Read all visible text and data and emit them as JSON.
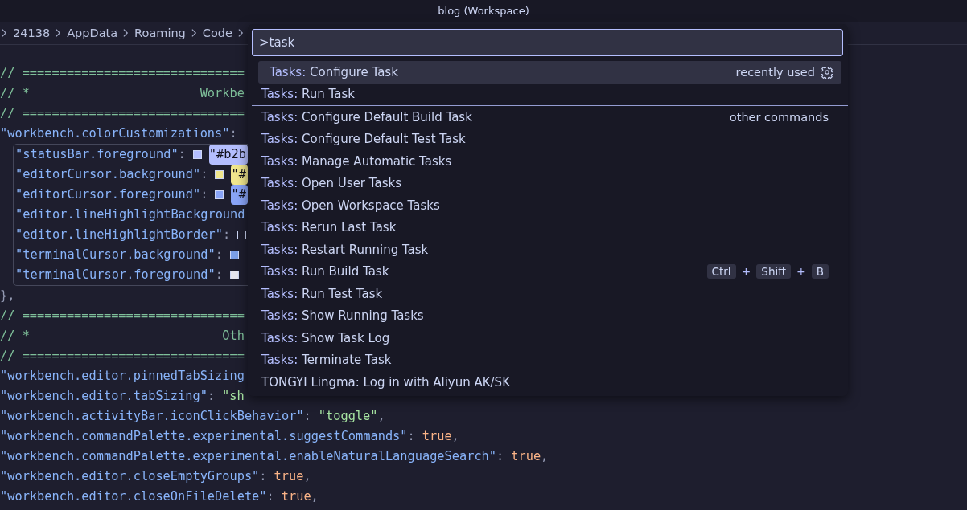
{
  "window": {
    "title": "blog (Workspace)"
  },
  "breadcrumb": [
    "24138",
    "AppData",
    "Roaming",
    "Code"
  ],
  "editor": {
    "lines_before": [
      [
        {
          "kind": "comment",
          "text": "// =============================="
        }
      ],
      [
        {
          "kind": "comment",
          "text": "// *                       Workbe"
        }
      ],
      [
        {
          "kind": "comment",
          "text": "// =============================="
        }
      ],
      [
        {
          "kind": "key",
          "text": "\"workbench.colorCustomizations\""
        },
        {
          "kind": "punct",
          "text": ":"
        }
      ]
    ],
    "block_lines": [
      [
        {
          "kind": "key",
          "text": "\"statusBar.foreground\""
        },
        {
          "kind": "punct",
          "text": ":"
        },
        {
          "kind": "swatch",
          "color": "#b4befe"
        },
        {
          "kind": "value",
          "text": "\"#b2b",
          "color": "#b4befe"
        }
      ],
      [
        {
          "kind": "key",
          "text": "\"editorCursor.background\""
        },
        {
          "kind": "punct",
          "text": ":"
        },
        {
          "kind": "swatch",
          "color": "#f0e68c"
        },
        {
          "kind": "value",
          "text": "\"#",
          "color": "#f0e68c"
        }
      ],
      [
        {
          "kind": "key",
          "text": "\"editorCursor.foreground\""
        },
        {
          "kind": "punct",
          "text": ":"
        },
        {
          "kind": "swatch",
          "color": "#89a4f7"
        },
        {
          "kind": "value",
          "text": "\"#",
          "color": "#89a4f7"
        }
      ],
      [
        {
          "kind": "key",
          "text": "\"editor.lineHighlightBackground"
        }
      ],
      [
        {
          "kind": "key",
          "text": "\"editor.lineHighlightBorder\""
        },
        {
          "kind": "punct",
          "text": ":"
        },
        {
          "kind": "swatch",
          "color": "#1e1e2e"
        }
      ],
      [
        {
          "kind": "key",
          "text": "\"terminalCursor.background\""
        },
        {
          "kind": "punct",
          "text": ":"
        },
        {
          "kind": "swatch",
          "color": "#7b9ee6"
        }
      ],
      [
        {
          "kind": "key",
          "text": "\"terminalCursor.foreground\""
        },
        {
          "kind": "punct",
          "text": ":"
        },
        {
          "kind": "swatch",
          "color": "#e6e6ee"
        }
      ]
    ],
    "lines_after": [
      [
        {
          "kind": "punct",
          "text": "},"
        }
      ],
      [
        {
          "kind": "comment",
          "text": "// =============================="
        }
      ],
      [
        {
          "kind": "comment",
          "text": "// *                          Oth"
        }
      ],
      [
        {
          "kind": "comment",
          "text": "// =============================="
        }
      ],
      [
        {
          "kind": "key",
          "text": "\"workbench.editor.pinnedTabSizing"
        }
      ],
      [
        {
          "kind": "key",
          "text": "\"workbench.editor.tabSizing\""
        },
        {
          "kind": "punct",
          "text": ":"
        },
        {
          "kind": "string",
          "text": "\"sh"
        }
      ],
      [
        {
          "kind": "key",
          "text": "\"workbench.activityBar.iconClickBehavior\""
        },
        {
          "kind": "punct",
          "text": ":"
        },
        {
          "kind": "string",
          "text": "\"toggle\""
        },
        {
          "kind": "punct",
          "text": ","
        }
      ],
      [
        {
          "kind": "key",
          "text": "\"workbench.commandPalette.experimental.suggestCommands\""
        },
        {
          "kind": "punct",
          "text": ":"
        },
        {
          "kind": "bool",
          "text": "true"
        },
        {
          "kind": "punct",
          "text": ","
        }
      ],
      [
        {
          "kind": "key",
          "text": "\"workbench.commandPalette.experimental.enableNaturalLanguageSearch\""
        },
        {
          "kind": "punct",
          "text": ":"
        },
        {
          "kind": "bool",
          "text": "true"
        },
        {
          "kind": "punct",
          "text": ","
        }
      ],
      [
        {
          "kind": "key",
          "text": "\"workbench.editor.closeEmptyGroups\""
        },
        {
          "kind": "punct",
          "text": ":"
        },
        {
          "kind": "bool",
          "text": "true"
        },
        {
          "kind": "punct",
          "text": ","
        }
      ],
      [
        {
          "kind": "key",
          "text": "\"workbench.editor.closeOnFileDelete\""
        },
        {
          "kind": "punct",
          "text": ":"
        },
        {
          "kind": "bool",
          "text": "true"
        },
        {
          "kind": "punct",
          "text": ","
        }
      ]
    ]
  },
  "command_palette": {
    "input": {
      "value": ">task"
    },
    "items": [
      {
        "category": "Tasks:",
        "title": "Configure Task",
        "matched": true,
        "selected": true,
        "detail": "recently used",
        "settings": true
      },
      {
        "category": "Tasks:",
        "title": "Run Task",
        "matched": true,
        "selected": false,
        "separator_after": true
      },
      {
        "category": "Tasks:",
        "title": "Configure Default Build Task",
        "matched": true,
        "selected": false,
        "detail": "other commands"
      },
      {
        "category": "Tasks:",
        "title": "Configure Default Test Task",
        "matched": true,
        "selected": false
      },
      {
        "category": "Tasks:",
        "title": "Manage Automatic Tasks",
        "matched": true,
        "selected": false
      },
      {
        "category": "Tasks:",
        "title": "Open User Tasks",
        "matched": true,
        "selected": false
      },
      {
        "category": "Tasks:",
        "title": "Open Workspace Tasks",
        "matched": true,
        "selected": false
      },
      {
        "category": "Tasks:",
        "title": "Rerun Last Task",
        "matched": true,
        "selected": false
      },
      {
        "category": "Tasks:",
        "title": "Restart Running Task",
        "matched": true,
        "selected": false
      },
      {
        "category": "Tasks:",
        "title": "Run Build Task",
        "matched": true,
        "selected": false,
        "keybinding": [
          {
            "kind": "key",
            "text": "Ctrl"
          },
          {
            "kind": "plus",
            "text": "+"
          },
          {
            "kind": "key",
            "text": "Shift"
          },
          {
            "kind": "plus",
            "text": "+"
          },
          {
            "kind": "key",
            "text": "B"
          }
        ]
      },
      {
        "category": "Tasks:",
        "title": "Run Test Task",
        "matched": true,
        "selected": false
      },
      {
        "category": "Tasks:",
        "title": "Show Running Tasks",
        "matched": true,
        "selected": false
      },
      {
        "category": "Tasks:",
        "title": "Show Task Log",
        "matched": true,
        "selected": false
      },
      {
        "category": "Tasks:",
        "title": "Terminate Task",
        "matched": true,
        "selected": false
      },
      {
        "category": "TONGYI Lingma:",
        "title": "Log in with Aliyun AK/SK",
        "matched": false,
        "selected": false
      }
    ]
  }
}
